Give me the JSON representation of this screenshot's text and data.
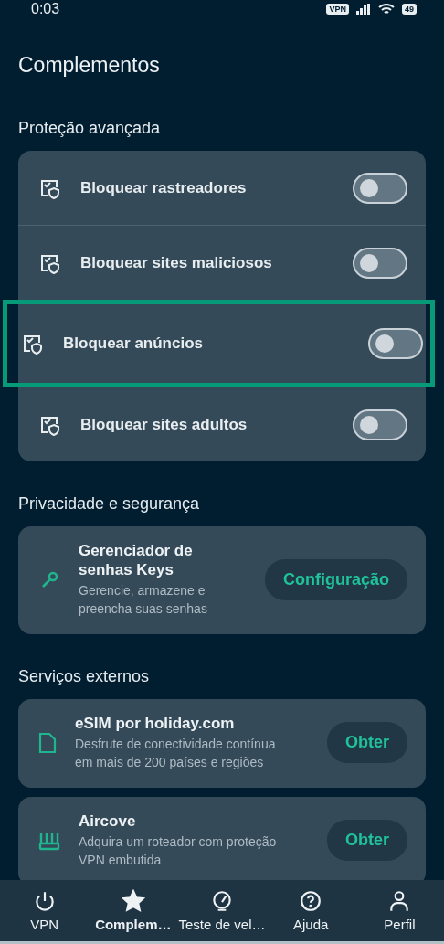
{
  "status_bar": {
    "time": "0:03",
    "vpn_badge": "VPN",
    "battery": "49"
  },
  "title": "Complementos",
  "sections": [
    {
      "heading": "Proteção avançada",
      "kind": "toggles",
      "items": [
        {
          "label": "Bloquear rastreadores",
          "on": false,
          "highlighted": false
        },
        {
          "label": "Bloquear sites maliciosos",
          "on": false,
          "highlighted": false
        },
        {
          "label": "Bloquear anúncios",
          "on": false,
          "highlighted": true
        },
        {
          "label": "Bloquear sites adultos",
          "on": false,
          "highlighted": false
        }
      ]
    },
    {
      "heading": "Privacidade e segurança",
      "kind": "services",
      "items": [
        {
          "title": "Gerenciador de senhas Keys",
          "description": "Gerencie, armazene e preencha suas senhas",
          "action": "Configuração"
        }
      ]
    },
    {
      "heading": "Serviços externos",
      "kind": "services",
      "items": [
        {
          "title": "eSIM por holiday.com",
          "description": "Desfrute de conectividade contínua em mais de 200 países e regiões",
          "action": "Obter"
        },
        {
          "title": "Aircove",
          "description": "Adquira um roteador com proteção VPN embutida",
          "action": "Obter"
        }
      ]
    }
  ],
  "nav": [
    {
      "label": "VPN",
      "selected": false
    },
    {
      "label": "Complem…",
      "selected": true
    },
    {
      "label": "Teste de vel…",
      "selected": false
    },
    {
      "label": "Ajuda",
      "selected": false
    },
    {
      "label": "Perfil",
      "selected": false
    }
  ]
}
